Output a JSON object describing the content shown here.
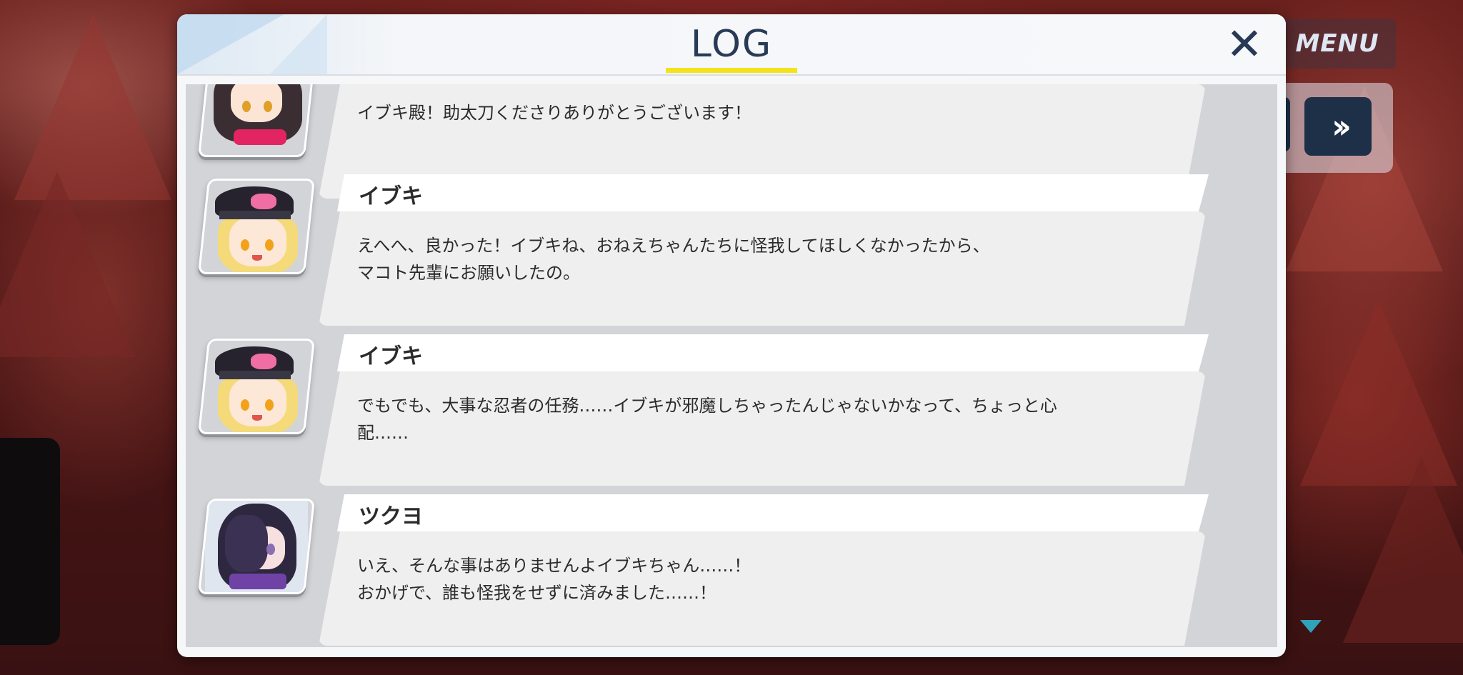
{
  "window": {
    "title": "LOG",
    "close_symbol": "✕"
  },
  "overlay": {
    "menu_label": "MENU",
    "skip_symbol": "»",
    "accent": "#f2e31c",
    "dark_navy": "#1d3047"
  },
  "entries": [
    {
      "speaker": "",
      "avatar": "dark-hair-girl-avatar",
      "lines": [
        "イブキ殿！助太刀くださりありがとうございます！"
      ]
    },
    {
      "speaker": "イブキ",
      "avatar": "ibuki-avatar",
      "lines": [
        "えへへ、良かった！イブキね、おねえちゃんたちに怪我してほしくなかったから、",
        "マコト先輩にお願いしたの。"
      ]
    },
    {
      "speaker": "イブキ",
      "avatar": "ibuki-avatar",
      "lines": [
        "でもでも、大事な忍者の任務……イブキが邪魔しちゃったんじゃないかなって、ちょっと心",
        "配……"
      ]
    },
    {
      "speaker": "ツクヨ",
      "avatar": "tsukuyo-avatar",
      "lines": [
        "いえ、そんな事はありませんよイブキちゃん……！",
        "おかげで、誰も怪我をせずに済みました……！"
      ]
    }
  ]
}
